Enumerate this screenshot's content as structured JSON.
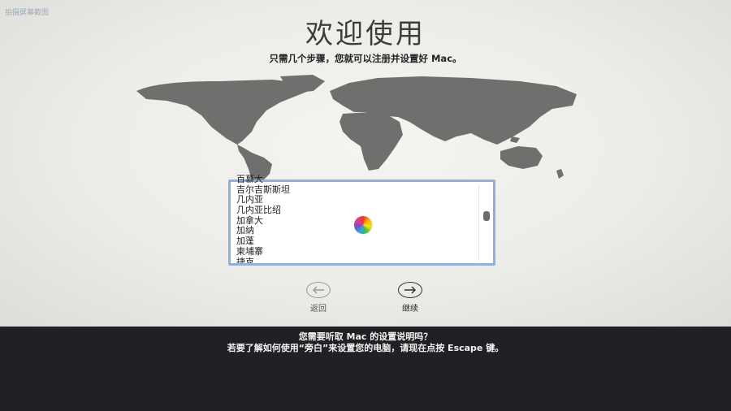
{
  "watermark": "拍摄屏幕截图",
  "setup": {
    "title": "欢迎使用",
    "subtitle": "只需几个步骤，您就可以注册并设置好 Mac。",
    "countries": [
      "百慕大",
      "吉尔吉斯斯坦",
      "几内亚",
      "几内亚比绍",
      "加拿大",
      "加纳",
      "加蓬",
      "柬埔寨",
      "捷克"
    ],
    "back_label": "返回",
    "continue_label": "继续"
  },
  "voiceover": {
    "line1": "您需要听取 Mac 的设置说明吗？",
    "line2": "若要了解如何使用“旁白”来设置您的电脑，请现在点按 Escape 键。"
  },
  "icons": {
    "back": "arrow-left-icon",
    "continue": "arrow-right-icon",
    "busy": "spinning-wheel-icon"
  }
}
